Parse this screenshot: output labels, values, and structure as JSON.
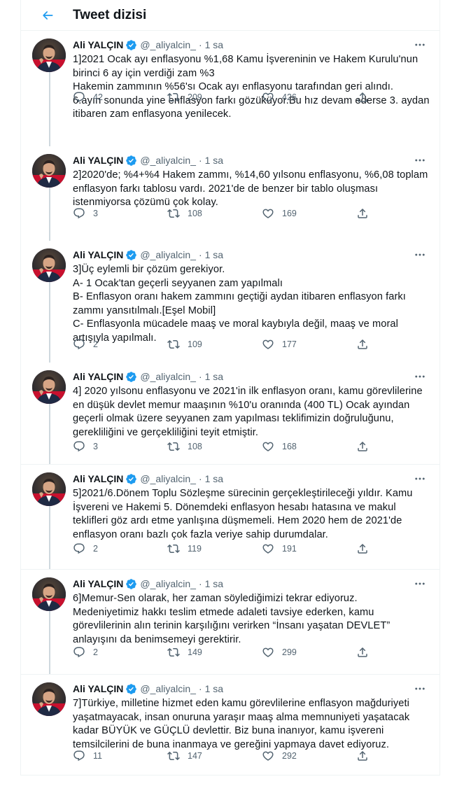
{
  "header": {
    "title": "Tweet dizisi",
    "back_icon": "arrow-left-icon"
  },
  "colors": {
    "accent": "#1d9bf0",
    "text_primary": "#0f1419",
    "text_secondary": "#536471",
    "divider": "#eff3f4",
    "thread_line": "#cfd9de"
  },
  "tweets": [
    {
      "name": "Ali YALÇIN",
      "handle": "@_aliyalcin_",
      "dot": "·",
      "time": "1 sa",
      "text": "1]2021 Ocak ayı enflasyonu %1,68 Kamu İşvereninin ve Hakem Kurulu'nun\nbirinci 6 ay için verdiği zam %3\nHakemin zammının %56'sı Ocak ayı enflasyonu tarafından geri alındı.\n6.ayın sonunda yine enflasyon farkı gözüküyor.Bu hız devam ederse 3. aydan\nitibaren zam enflasyona yenilecek.",
      "replies": "42",
      "retweets": "209",
      "likes": "426"
    },
    {
      "name": "Ali YALÇIN",
      "handle": "@_aliyalcin_",
      "dot": "·",
      "time": "1 sa",
      "text": "2]2020'de; %4+%4 Hakem zammı, %14,60 yılsonu enflasyonu, %6,08 toplam\nenflasyon farkı tablosu vardı. 2021'de de benzer bir tablo oluşması\nistenmiyorsa çözümü çok kolay.",
      "replies": "3",
      "retweets": "108",
      "likes": "169"
    },
    {
      "name": "Ali YALÇIN",
      "handle": "@_aliyalcin_",
      "dot": "·",
      "time": "1 sa",
      "text": "3]Üç eylemli bir çözüm gerekiyor.\nA- 1 Ocak'tan geçerli seyyanen zam yapılmalı\nB- Enflasyon oranı hakem zammını geçtiği aydan itibaren enflasyon farkı\nzammı yansıtılmalı.[Eşel Mobil]\nC- Enflasyonla mücadele maaş ve moral kaybıyla değil, maaş ve moral\nartışıyla yapılmalı.",
      "replies": "2",
      "retweets": "109",
      "likes": "177"
    },
    {
      "name": "Ali YALÇIN",
      "handle": "@_aliyalcin_",
      "dot": "·",
      "time": "1 sa",
      "text": "4] 2020 yılsonu enflasyonu ve 2021'in ilk enflasyon oranı, kamu görevlilerine\nen düşük devlet memur maaşının %10'u oranında (400 TL) Ocak ayından\ngeçerli olmak üzere seyyanen zam yapılması teklifimizin doğruluğunu,\ngerekliliğini ve gerçekliliğini teyit etmiştir.",
      "replies": "3",
      "retweets": "108",
      "likes": "168"
    },
    {
      "name": "Ali YALÇIN",
      "handle": "@_aliyalcin_",
      "dot": "·",
      "time": "1 sa",
      "text": "5]2021/6.Dönem Toplu Sözleşme sürecinin gerçekleştirileceği yıldır. Kamu\nİşvereni ve Hakemi 5. Dönemdeki enflasyon hesabı hatasına ve makul\nteklifleri göz ardı etme yanlışına düşmemeli. Hem 2020 hem de 2021'de\nenflasyon oranı bazlı çok fazla veriye sahip durumdalar.",
      "replies": "2",
      "retweets": "119",
      "likes": "191"
    },
    {
      "name": "Ali YALÇIN",
      "handle": "@_aliyalcin_",
      "dot": "·",
      "time": "1 sa",
      "text": "6]Memur-Sen olarak, her zaman söylediğimizi tekrar ediyoruz.\nMedeniyetimiz hakkı teslim etmede adaleti tavsiye ederken, kamu\ngörevlilerinin alın terinin karşılığını verirken “İnsanı yaşatan DEVLET”\nanlayışını da benimsemeyi gerektirir.",
      "replies": "2",
      "retweets": "149",
      "likes": "299"
    },
    {
      "name": "Ali YALÇIN",
      "handle": "@_aliyalcin_",
      "dot": "·",
      "time": "1 sa",
      "text": "7]Türkiye, milletine hizmet eden kamu görevlilerine enflasyon mağduriyeti\nyaşatmayacak, insan onuruna yaraşır maaş alma memnuniyeti yaşatacak\nkadar BÜYÜK ve GÜÇLÜ devlettir. Biz buna inanıyor, kamu işvereni\ntemsilcilerini de buna inanmaya ve gereğini yapmaya davet ediyoruz.",
      "replies": "11",
      "retweets": "147",
      "likes": "292"
    }
  ]
}
